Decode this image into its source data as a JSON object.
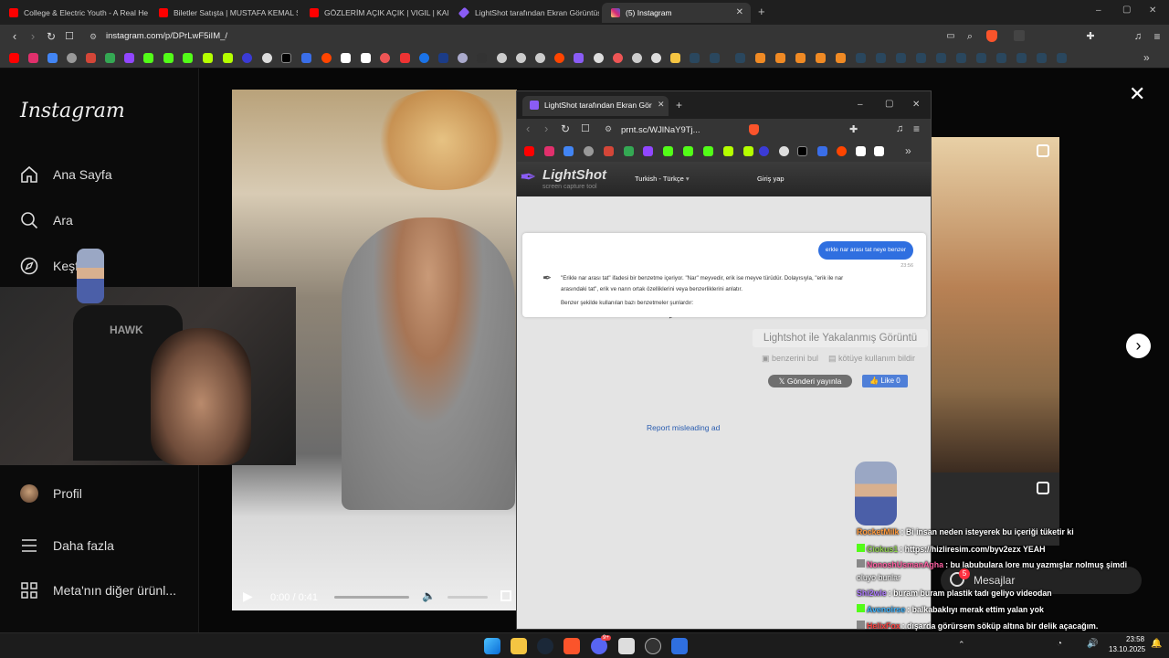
{
  "browser": {
    "tabs": [
      {
        "title": "College & Electric Youth - A Real Her",
        "color": "#ff0000"
      },
      {
        "title": "Biletler Satışta | MUSTAFA KEMAL Sin",
        "color": "#ff0000"
      },
      {
        "title": "GÖZLERİM AÇIK AÇIK | VIGIL | KAIJRI",
        "color": "#ff0000"
      },
      {
        "title": "LightShot tarafından Ekran Görüntüs",
        "color": "#8a5cf5"
      },
      {
        "title": "(5) Instagram",
        "color": "#e1306c"
      }
    ],
    "new_tab": "+",
    "url": "instagram.com/p/DPrLwF5iIM_/",
    "window_controls": [
      "–",
      "▢",
      "✕"
    ]
  },
  "instagram": {
    "logo": "Instagram",
    "nav": [
      {
        "label": "Ana Sayfa",
        "icon": "home-icon"
      },
      {
        "label": "Ara",
        "icon": "search-icon"
      },
      {
        "label": "Keşfet",
        "icon": "compass-icon"
      },
      {
        "label": "Profil",
        "icon": "avatar"
      },
      {
        "label": "Daha fazla",
        "icon": "menu-icon"
      },
      {
        "label": "Meta'nın diğer ürünl...",
        "icon": "grid-icon"
      }
    ],
    "video_time": "0:00 / 0:41",
    "messages_label": "Mesajlar",
    "messages_badge": "5"
  },
  "webcam": {
    "chair_brand": "HAWK"
  },
  "lightshot": {
    "tab_title": "LightShot tarafından Ekran Görün",
    "url": "prnt.sc/WJlNaY9Tj...",
    "logo": "LightShot",
    "tagline": "screen capture tool",
    "language": "Turkish - Türkçe",
    "login": "Giriş yap",
    "user_message": "erkle nar arası tat neye benzer",
    "message_time": "23:56",
    "reply_line1": "\"Erikle nar arası tat\" ifadesi bir benzetme içeriyor. \"Nar\" meyvedir, erik ise meyve türüdür. Dolayısıyla, \"erik ile nar",
    "reply_line2": "arasındaki tat\", erik ve narın ortak özelliklerini veya benzerliklerini anlatır.",
    "reply_line3": "Benzer şekilde kullanılan bazı benzetmeler şunlardır:",
    "captured_title": "Lightshot ile Yakalanmış Görüntü",
    "find_similar": "benzerini bul",
    "report_abuse": "kötüye kullanım bildir",
    "post_button": "Gönderi yayınla",
    "like_button": "Like 0",
    "report_ad": "Report misleading ad"
  },
  "chat": [
    {
      "user": "RocketMilk",
      "text": ": Bi insan neden isteyerek bu içeriği tüketir ki",
      "color": "#ff9a3c"
    },
    {
      "user": "Ciokus1",
      "text": ": https://hizliresim.com/byv2ezx YEAH",
      "color": "#8fd14f"
    },
    {
      "user": "NonoshUsmanAgha",
      "text": ": bu labubulara lore mu yazmışlar nolmuş şimdi",
      "color": "#ff5fa2"
    },
    {
      "user": "",
      "text": "oluyo bunlar",
      "color": "#ffffff"
    },
    {
      "user": "Shi2wle",
      "text": ": buram buram plastik tadı geliyo videodan",
      "color": "#b07cff"
    },
    {
      "user": "Avenoirse",
      "text": ": balkabaklıyı merak ettim yalan yok",
      "color": "#3fb5ff"
    },
    {
      "user": "HelixFox",
      "text": ": dışarda görürsem söküp altına bir delik açacağım.",
      "color": "#ff4040"
    }
  ],
  "taskbar": {
    "time": "23:58",
    "date": "13.10.2025",
    "discord_badge": "9+"
  }
}
